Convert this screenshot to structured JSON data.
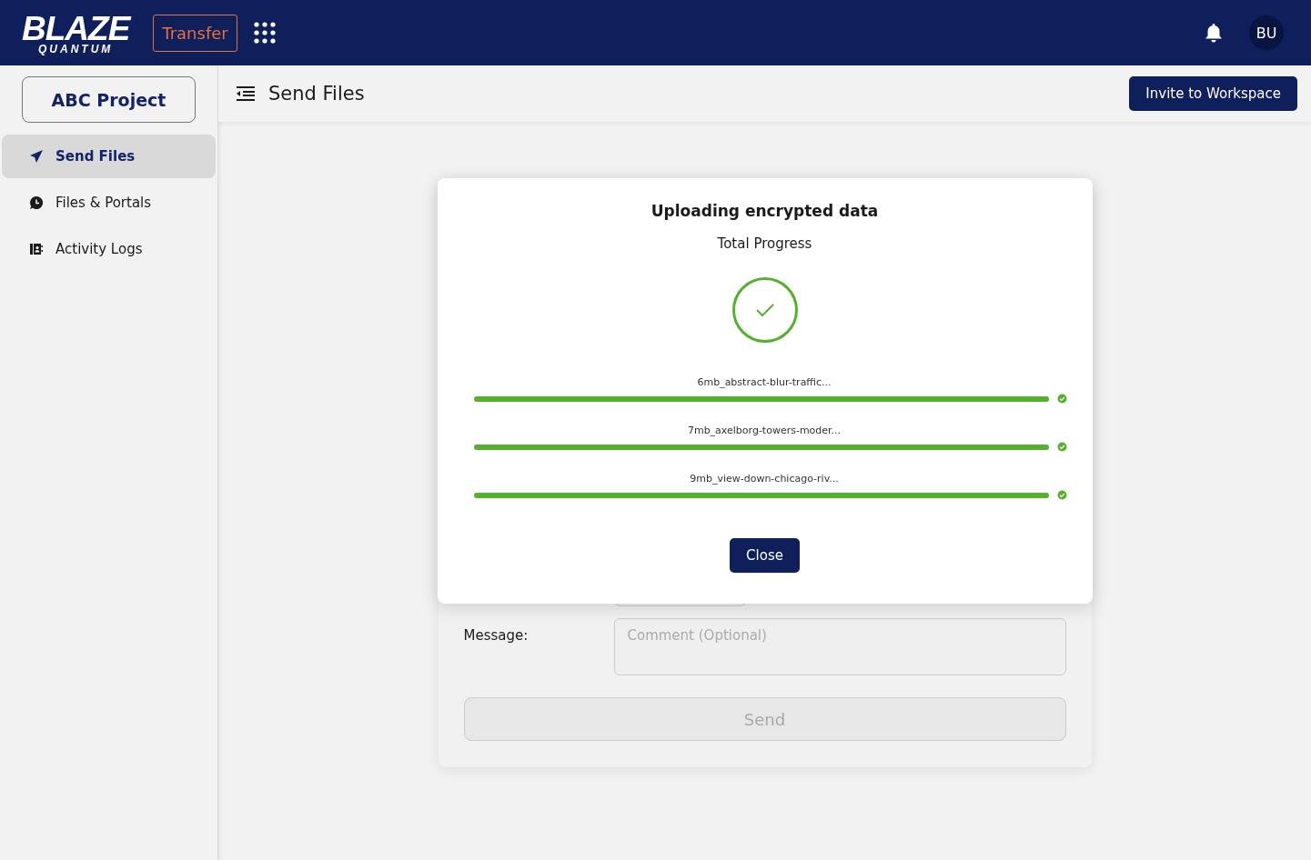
{
  "header": {
    "logo": {
      "wordmark": "BLAZE",
      "tagline": "QUANTUM"
    },
    "app_button": "Transfer",
    "avatar": "BU"
  },
  "sidebar": {
    "project_button": "ABC Project",
    "items": [
      {
        "label": "Send Files",
        "kind": "send",
        "selected": true
      },
      {
        "label": "Files & Portals",
        "kind": "files",
        "selected": false
      },
      {
        "label": "Activity Logs",
        "kind": "logs",
        "selected": false
      }
    ]
  },
  "toolbar": {
    "title": "Send Files",
    "invite_button": "Invite to Workspace"
  },
  "form": {
    "message_label": "Message:",
    "message_placeholder": "Comment (Optional)",
    "send_button": "Send",
    "send_disabled": true
  },
  "modal": {
    "title": "Uploading encrypted data",
    "subtitle": "Total Progress",
    "complete": true,
    "files": [
      {
        "name": "6mb_abstract-blur-traffic...",
        "level": 1,
        "done": true
      },
      {
        "name": "7mb_axelborg-towers-moder...",
        "level": 1,
        "done": true
      },
      {
        "name": "9mb_view-down-chicago-riv...",
        "level": 1,
        "done": true
      }
    ],
    "close_button": "Close"
  }
}
